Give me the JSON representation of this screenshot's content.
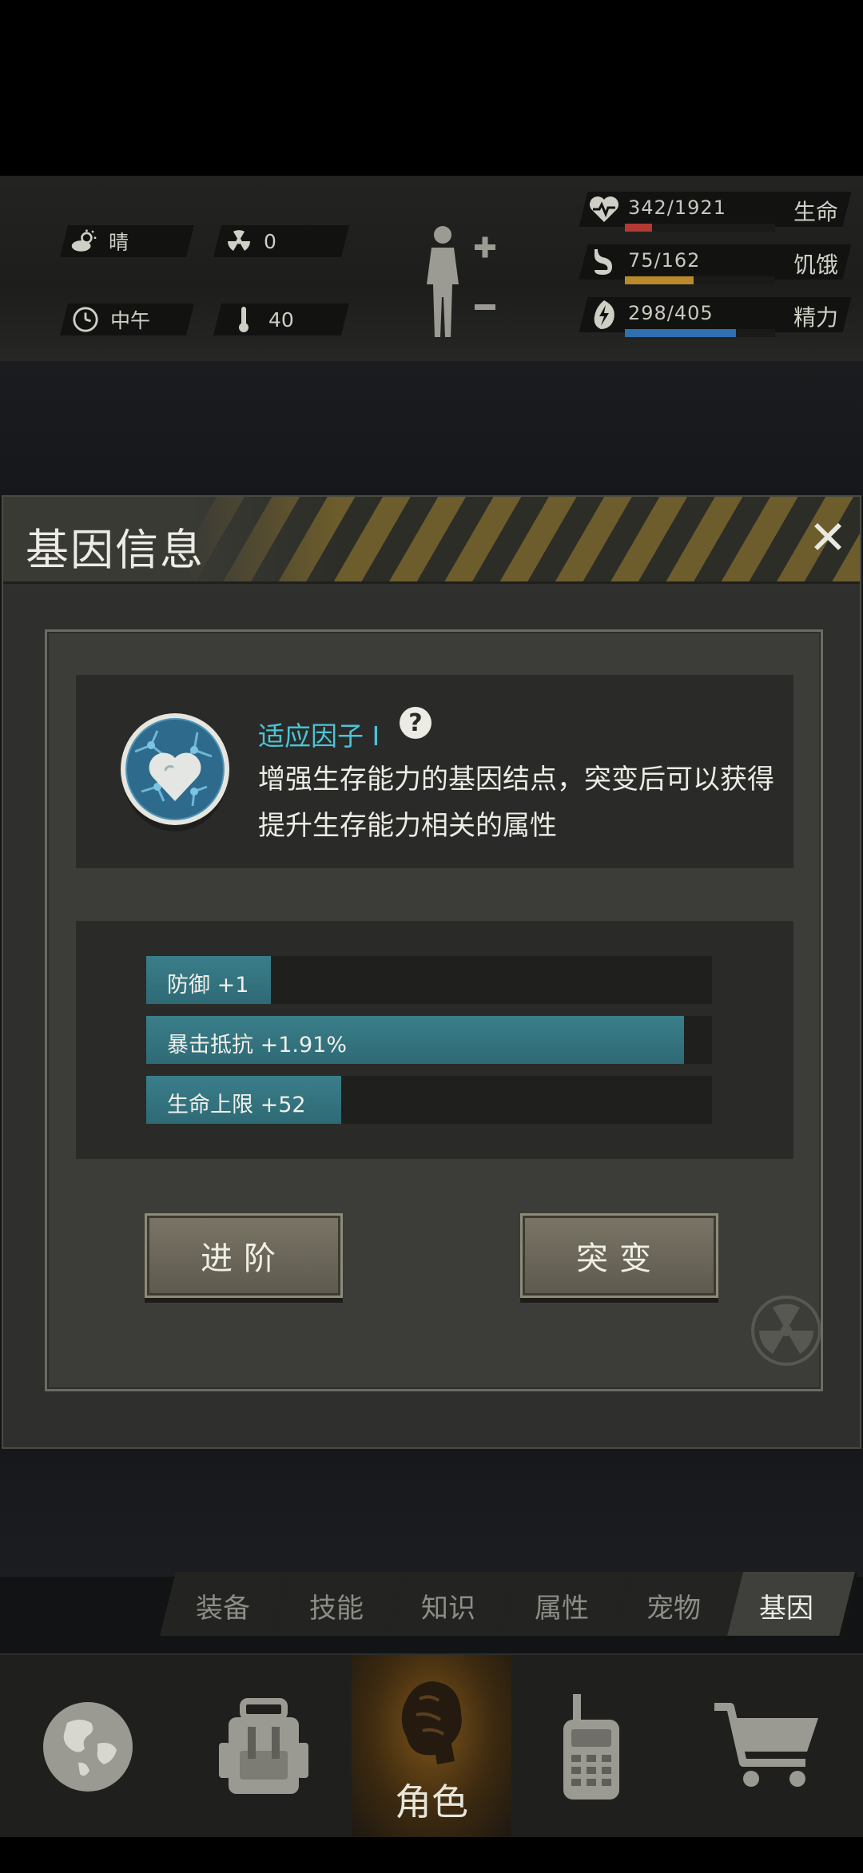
{
  "status": {
    "weather": {
      "icon": "cloudy-sun-icon",
      "label": "晴"
    },
    "radiation": {
      "icon": "radiation-icon",
      "value": "0"
    },
    "time": {
      "icon": "clock-icon",
      "label": "中午"
    },
    "temperature": {
      "icon": "thermometer-icon",
      "value": "40"
    },
    "bars": [
      {
        "icon": "heart-icon",
        "value": "342/1921",
        "label": "生命",
        "fraction": 0.18,
        "color": "#b23a32"
      },
      {
        "icon": "stomach-icon",
        "value": "75/162",
        "label": "饥饿",
        "fraction": 0.46,
        "color": "#b98a2c"
      },
      {
        "icon": "energy-icon",
        "value": "298/405",
        "label": "精力",
        "fraction": 0.74,
        "color": "#2f6fb2"
      }
    ]
  },
  "dialog": {
    "title": "基因信息",
    "close": "✕",
    "gene": {
      "name": "适应因子 I",
      "help": "?",
      "description": "增强生存能力的基因结点，突变后可以获得提升生存能力相关的属性"
    },
    "stats": [
      {
        "label": "防御 +1",
        "fraction": 0.22
      },
      {
        "label": "暴击抵抗 +1.91%",
        "fraction": 0.95
      },
      {
        "label": "生命上限 +52",
        "fraction": 0.345
      }
    ],
    "buttons": {
      "advance": "进阶",
      "mutate": "突变"
    }
  },
  "tabs": [
    {
      "label": "装备",
      "active": false
    },
    {
      "label": "技能",
      "active": false
    },
    {
      "label": "知识",
      "active": false
    },
    {
      "label": "属性",
      "active": false
    },
    {
      "label": "宠物",
      "active": false
    },
    {
      "label": "基因",
      "active": true
    }
  ],
  "nav": [
    {
      "icon": "globe-icon"
    },
    {
      "icon": "backpack-icon"
    },
    {
      "icon": "character-icon",
      "label": "角色",
      "active": true
    },
    {
      "icon": "radio-icon"
    },
    {
      "icon": "cart-icon"
    }
  ]
}
